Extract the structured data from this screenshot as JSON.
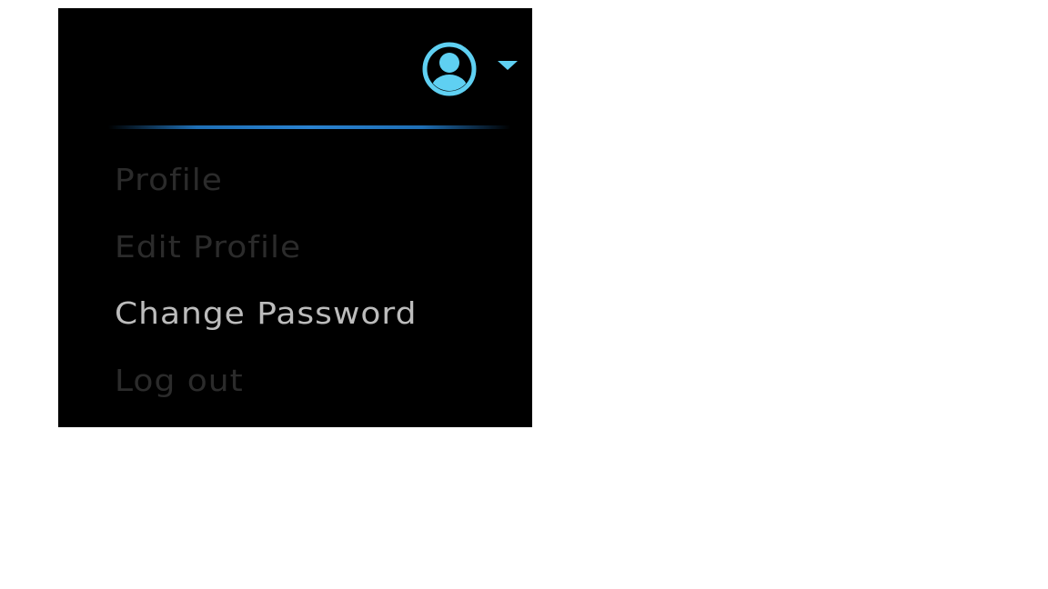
{
  "user_menu": {
    "avatar_icon": "user-circle-icon",
    "caret_icon": "caret-down-icon",
    "accent_color": "#5fd0f2",
    "divider_color": "#2a82d0",
    "items": [
      {
        "label": "Profile",
        "state": "normal"
      },
      {
        "label": "Edit Profile",
        "state": "normal"
      },
      {
        "label": "Change Password",
        "state": "hover"
      },
      {
        "label": "Log out",
        "state": "normal"
      }
    ]
  }
}
